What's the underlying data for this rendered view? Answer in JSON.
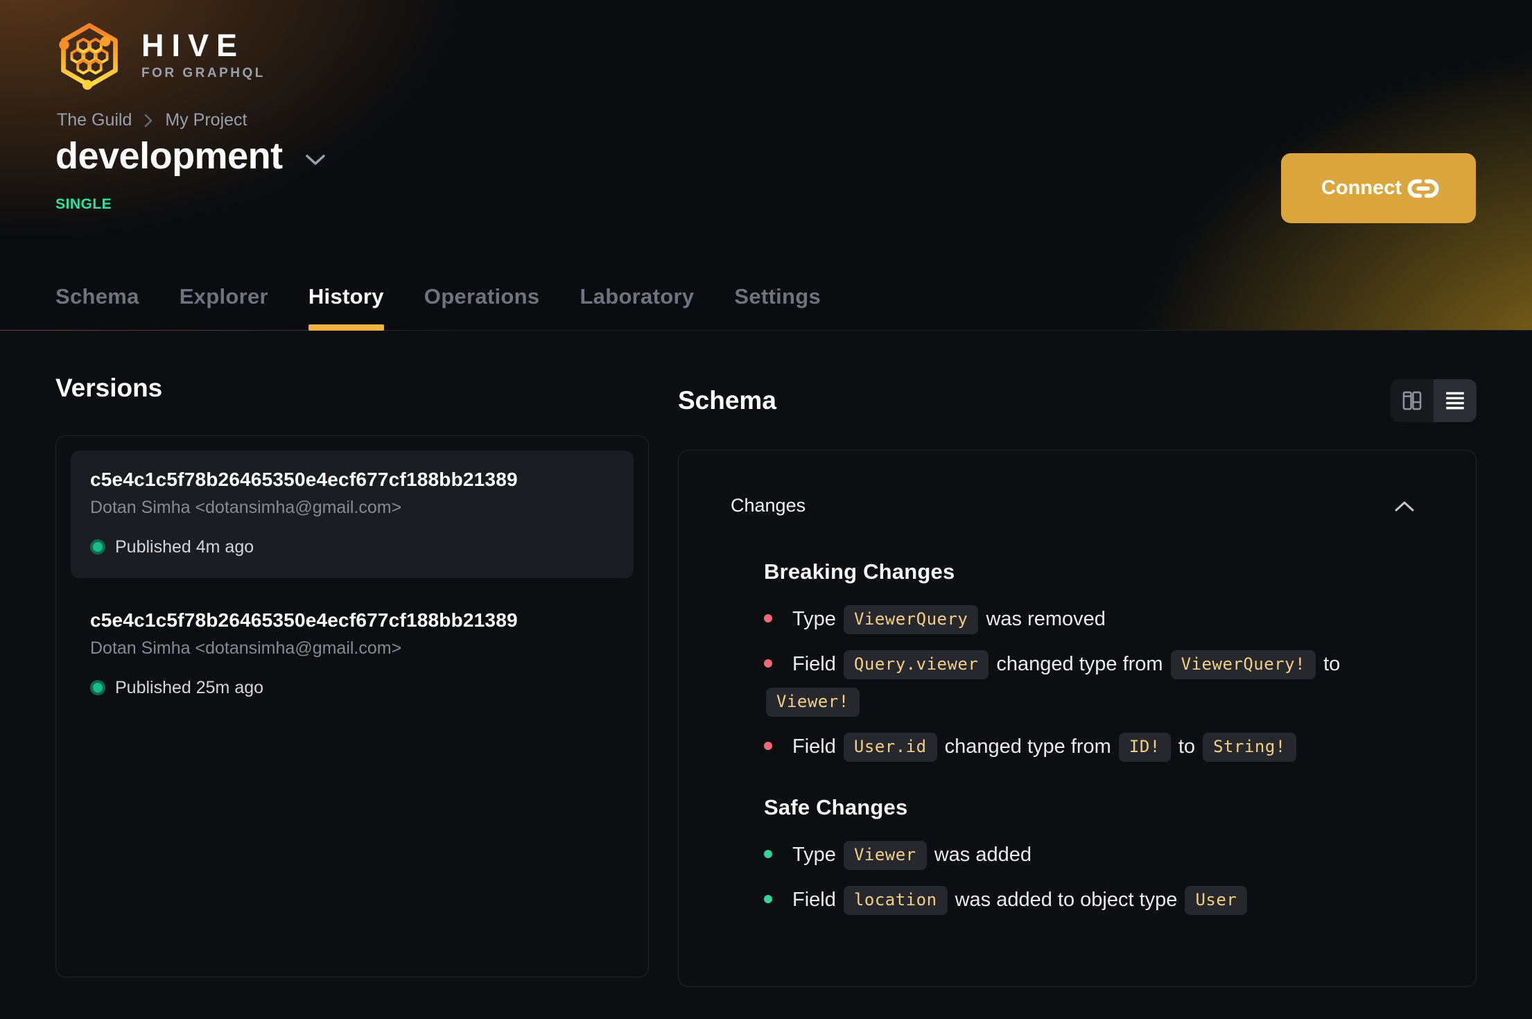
{
  "brand": {
    "name": "HIVE",
    "tagline": "FOR GRAPHQL"
  },
  "breadcrumb": {
    "items": [
      "The Guild",
      "My Project"
    ]
  },
  "target": {
    "name": "development",
    "type": "SINGLE"
  },
  "connect": {
    "label": "Connect"
  },
  "tabs": {
    "items": [
      {
        "label": "Schema",
        "active": false
      },
      {
        "label": "Explorer",
        "active": false
      },
      {
        "label": "History",
        "active": true
      },
      {
        "label": "Operations",
        "active": false
      },
      {
        "label": "Laboratory",
        "active": false
      },
      {
        "label": "Settings",
        "active": false
      }
    ]
  },
  "versions": {
    "heading": "Versions",
    "items": [
      {
        "hash": "c5e4c1c5f78b26465350e4ecf677cf188bb21389",
        "author": "Dotan Simha <dotansimha@gmail.com>",
        "status": "Published 4m ago",
        "highlighted": true
      },
      {
        "hash": "c5e4c1c5f78b26465350e4ecf677cf188bb21389",
        "author": "Dotan Simha <dotansimha@gmail.com>",
        "status": "Published 25m ago",
        "highlighted": false
      }
    ]
  },
  "schema": {
    "heading": "Schema",
    "view_toggle": {
      "options": [
        "columns-view",
        "list-view"
      ],
      "active": "list-view"
    },
    "changes": {
      "label": "Changes",
      "sections": [
        {
          "title": "Breaking Changes",
          "severity": "breaking",
          "items": [
            [
              {
                "t": "text",
                "v": "Type "
              },
              {
                "t": "code",
                "v": "ViewerQuery"
              },
              {
                "t": "text",
                "v": " was removed"
              }
            ],
            [
              {
                "t": "text",
                "v": "Field "
              },
              {
                "t": "code",
                "v": "Query.viewer"
              },
              {
                "t": "text",
                "v": " changed type from "
              },
              {
                "t": "code",
                "v": "ViewerQuery!"
              },
              {
                "t": "text",
                "v": " to "
              },
              {
                "t": "code",
                "v": "Viewer!"
              }
            ],
            [
              {
                "t": "text",
                "v": "Field "
              },
              {
                "t": "code",
                "v": "User.id"
              },
              {
                "t": "text",
                "v": " changed type from "
              },
              {
                "t": "code",
                "v": "ID!"
              },
              {
                "t": "text",
                "v": " to "
              },
              {
                "t": "code",
                "v": "String!"
              }
            ]
          ]
        },
        {
          "title": "Safe Changes",
          "severity": "safe",
          "items": [
            [
              {
                "t": "text",
                "v": "Type "
              },
              {
                "t": "code",
                "v": "Viewer"
              },
              {
                "t": "text",
                "v": " was added"
              }
            ],
            [
              {
                "t": "text",
                "v": "Field "
              },
              {
                "t": "code",
                "v": "location"
              },
              {
                "t": "text",
                "v": " was added to object type "
              },
              {
                "t": "code",
                "v": "User"
              }
            ]
          ]
        }
      ]
    }
  },
  "colors": {
    "accent": "#f0b43e",
    "connect_bg": "#dca63e",
    "single_green": "#2ee0a4",
    "breaking_red": "#ee6a76",
    "safe_green": "#34d399",
    "code_amber": "#f2d083"
  }
}
